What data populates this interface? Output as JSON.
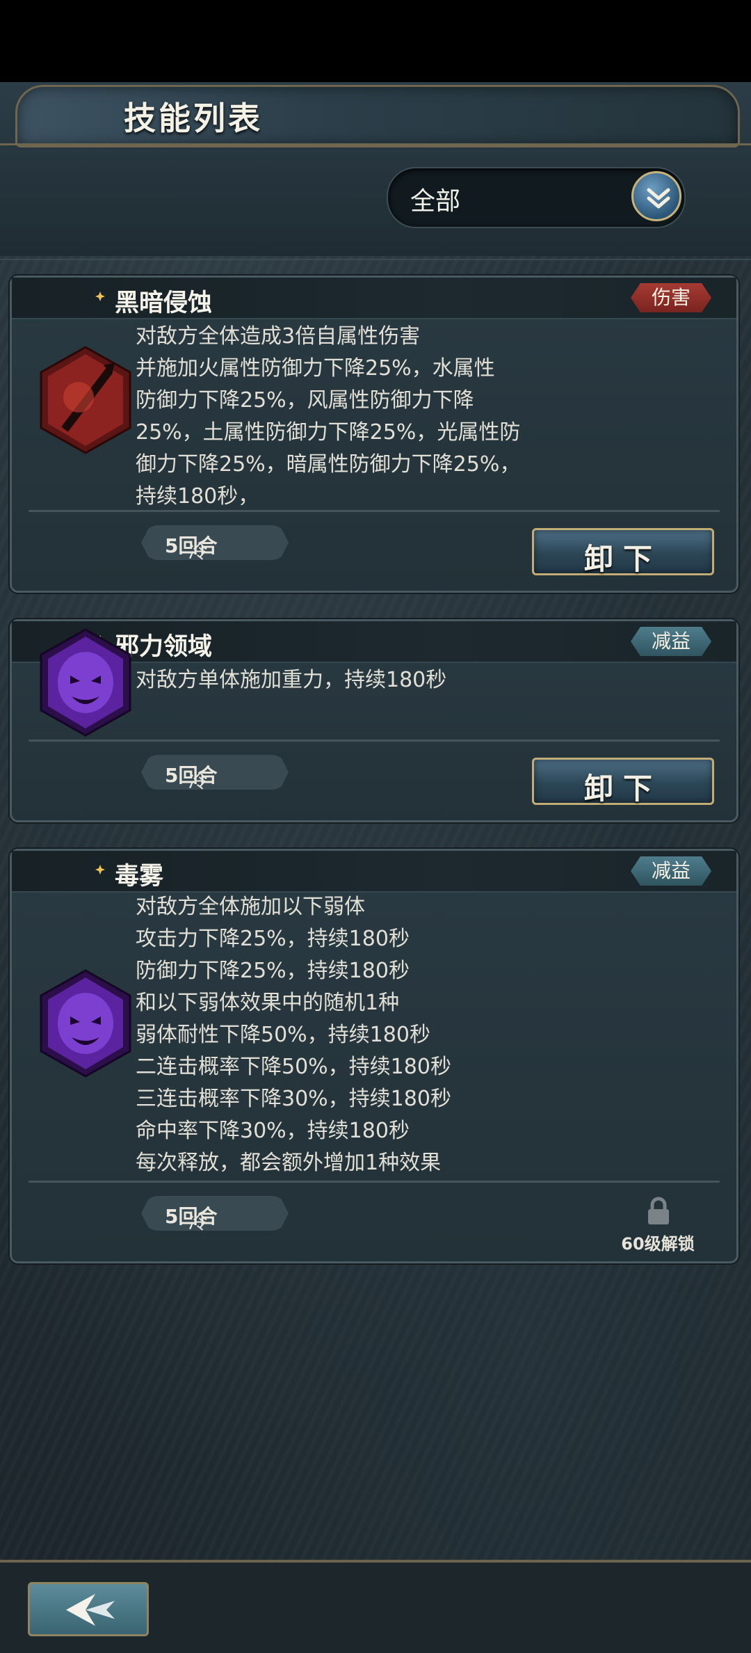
{
  "header": {
    "title": "技能列表"
  },
  "filter": {
    "selected": "全部"
  },
  "skills": [
    {
      "name": "黑暗侵蚀",
      "tag": "伤害",
      "tag_color": "#a63a33",
      "icon": "dark-erosion-icon",
      "description": [
        "对敌方全体造成3倍自属性伤害",
        "并施加火属性防御力下降25%，水属性",
        "防御力下降25%，风属性防御力下降",
        "25%，土属性防御力下降25%，光属性防",
        "御力下降25%，暗属性防御力下降25%，",
        "持续180秒，"
      ],
      "cooldown_label": "冷却:",
      "cooldown_value": "5回合",
      "action": "卸下"
    },
    {
      "name": "邪力领域",
      "tag": "减益",
      "tag_color": "#3f6b7a",
      "icon": "evil-domain-icon",
      "description": [
        "对敌方单体施加重力，持续180秒"
      ],
      "cooldown_label": "冷却:",
      "cooldown_value": "5回合",
      "action": "卸下"
    },
    {
      "name": "毒雾",
      "tag": "减益",
      "tag_color": "#3f6b7a",
      "icon": "poison-fog-icon",
      "description": [
        "对敌方全体施加以下弱体",
        "攻击力下降25%，持续180秒",
        "防御力下降25%，持续180秒",
        "和以下弱体效果中的随机1种",
        "弱体耐性下降50%，持续180秒",
        "二连击概率下降50%，持续180秒",
        "三连击概率下降30%，持续180秒",
        "命中率下降30%，持续180秒",
        "每次释放，都会额外增加1种效果"
      ],
      "cooldown_label": "冷却:",
      "cooldown_value": "5回合",
      "lock_text": "60级解锁"
    }
  ]
}
